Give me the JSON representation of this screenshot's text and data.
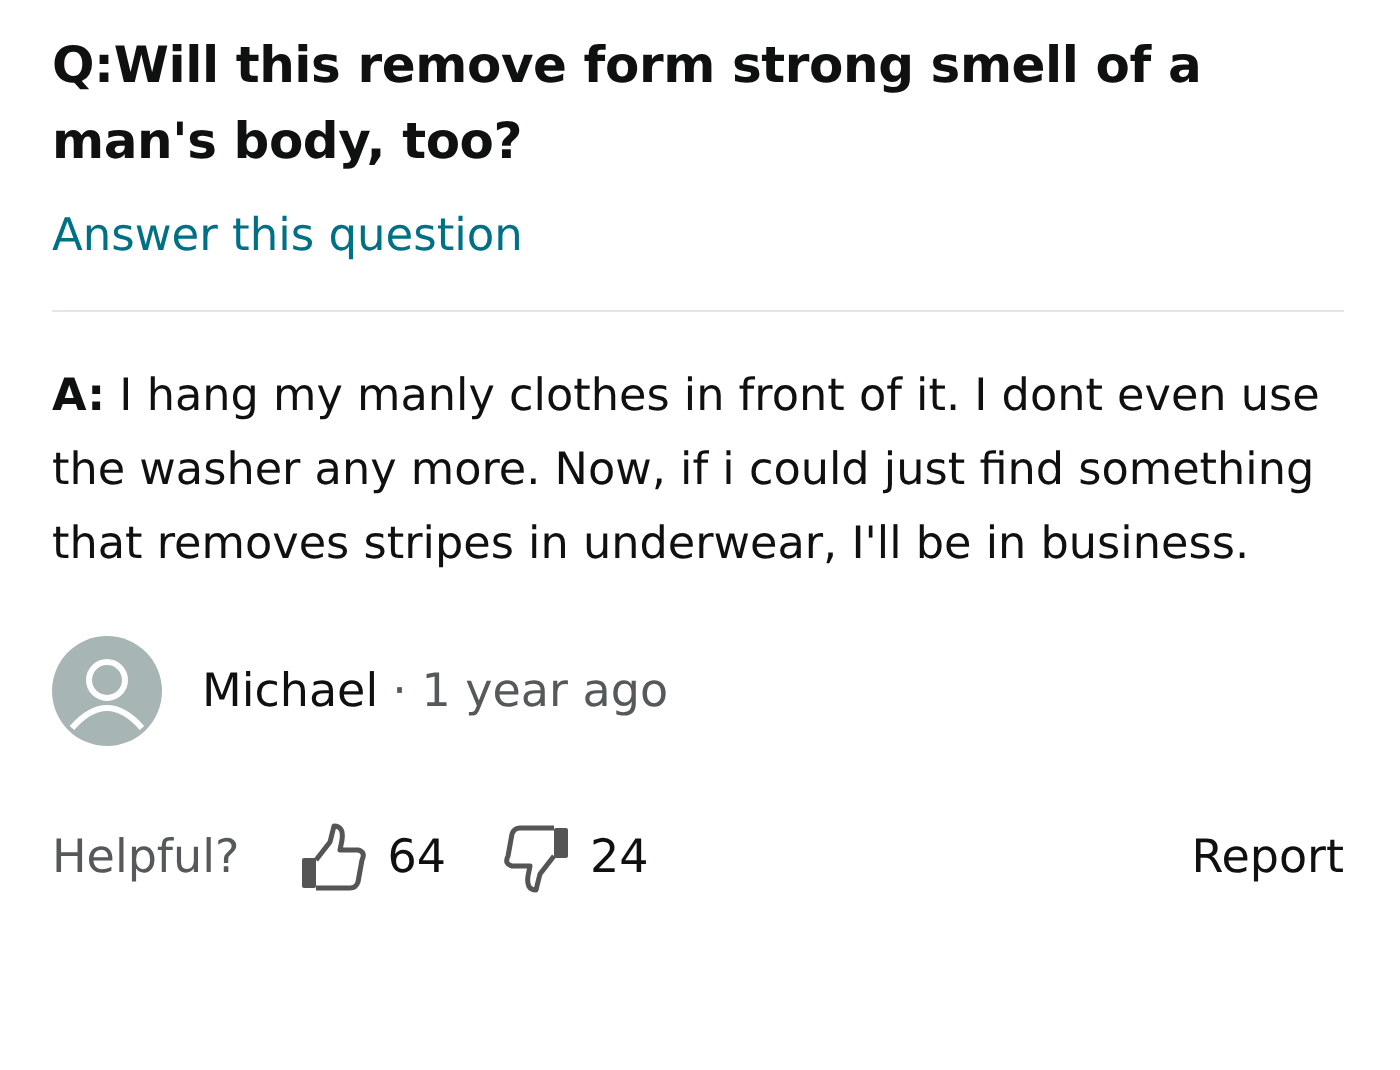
{
  "question": {
    "text": "Q:Will this remove form strong smell of a man's body, too?",
    "answer_link": "Answer this question"
  },
  "answer": {
    "text": "**A:** I hang my manly clothes in front of it. I dont even use the washer any more. Now, if i could just find something that removes stripes in underwear, I'll be in business.",
    "author": "Michael",
    "time": "· 1 year ago"
  },
  "actions": {
    "helpful_label": "Helpful?",
    "upvotes": "64",
    "downvotes": "24",
    "report": "Report"
  }
}
